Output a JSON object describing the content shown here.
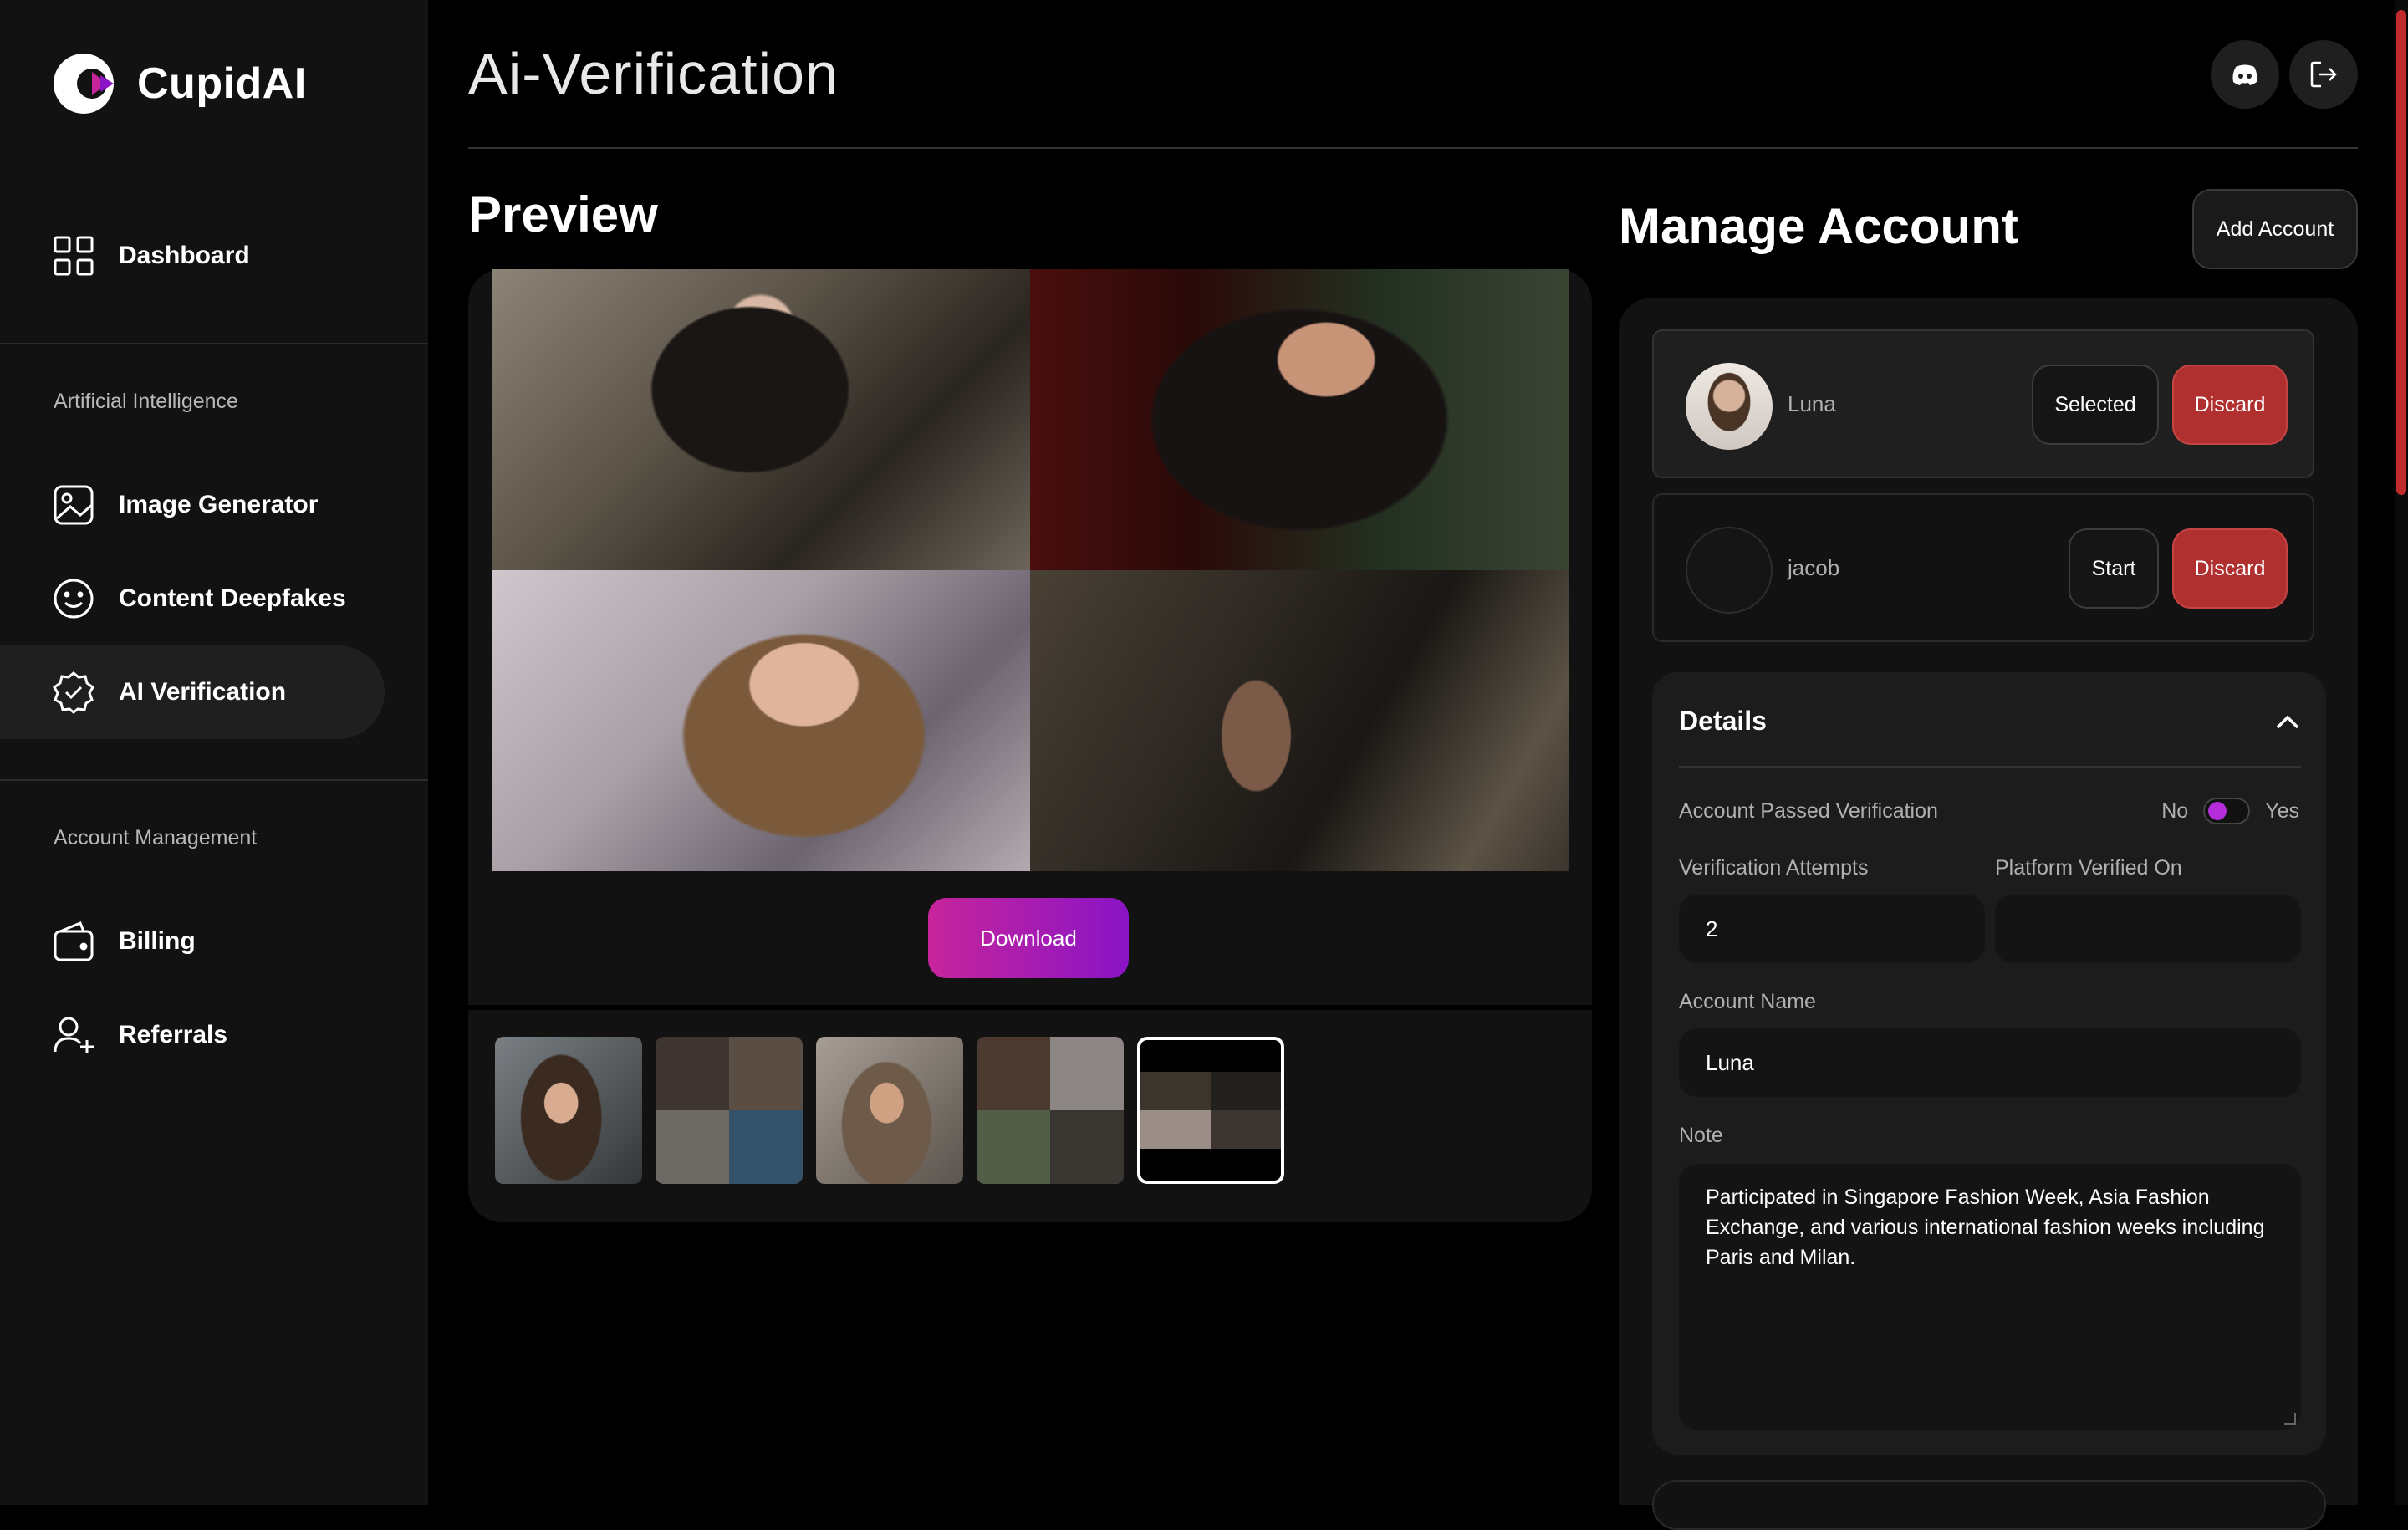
{
  "app": {
    "name": "CupidAI"
  },
  "sidebar": {
    "nav": [
      {
        "label": "Dashboard"
      }
    ],
    "sections": [
      {
        "label": "Artificial Intelligence",
        "items": [
          {
            "label": "Image Generator"
          },
          {
            "label": "Content Deepfakes"
          },
          {
            "label": "AI Verification"
          }
        ]
      },
      {
        "label": "Account Management",
        "items": [
          {
            "label": "Billing"
          },
          {
            "label": "Referrals"
          }
        ]
      }
    ],
    "active": "AI Verification"
  },
  "header": {
    "title": "Ai-Verification"
  },
  "preview": {
    "title": "Preview",
    "download_label": "Download"
  },
  "manage": {
    "title": "Manage Account",
    "add_account_label": "Add Account",
    "accounts": [
      {
        "name": "Luna",
        "action_label": "Selected",
        "discard_label": "Discard",
        "selected": true
      },
      {
        "name": "jacob",
        "action_label": "Start",
        "discard_label": "Discard",
        "selected": false
      }
    ]
  },
  "details": {
    "title": "Details",
    "passed_label": "Account Passed Verification",
    "toggle_no": "No",
    "toggle_yes": "Yes",
    "attempts_label": "Verification Attempts",
    "attempts_value": "2",
    "platform_label": "Platform Verified On",
    "platform_value": "",
    "account_name_label": "Account Name",
    "account_name_value": "Luna",
    "note_label": "Note",
    "note_value": "Participated in Singapore Fashion Week, Asia Fashion Exchange, and various international fashion weeks including Paris and Milan."
  },
  "colors": {
    "accent_start": "#c7259b",
    "accent_end": "#8a14c6",
    "discard": "#b03030"
  }
}
